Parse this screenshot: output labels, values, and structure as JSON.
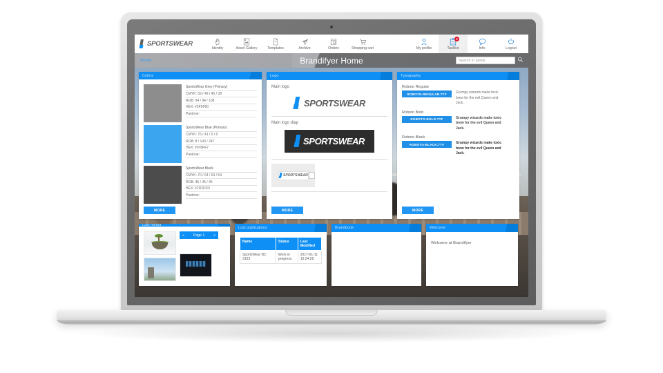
{
  "topnav": {
    "brand": "SPORTSWEAR",
    "left_items": [
      {
        "label": "Identity",
        "icon": "hand-identity-icon"
      },
      {
        "label": "Asset Gallery",
        "icon": "image-gallery-icon"
      },
      {
        "label": "Templates",
        "icon": "document-template-icon"
      },
      {
        "label": "Archive",
        "icon": "paper-plane-archive-icon"
      },
      {
        "label": "Orders",
        "icon": "box-orders-icon"
      },
      {
        "label": "Shopping cart",
        "icon": "shopping-cart-icon"
      }
    ],
    "right_items": [
      {
        "label": "My profile",
        "icon": "user-profile-icon",
        "badge": "",
        "active": false
      },
      {
        "label": "Tasklist",
        "icon": "clipboard-tasklist-icon",
        "badge": "2",
        "active": true
      },
      {
        "label": "Info",
        "icon": "speech-bubble-info-icon",
        "badge": "",
        "active": false
      },
      {
        "label": "Logout",
        "icon": "power-logout-icon",
        "badge": "",
        "active": false
      }
    ]
  },
  "subbar": {
    "breadcrumb": "Home",
    "title": "Brandifyer Home",
    "search_placeholder": "Search in portal",
    "search_value": "",
    "search_icon": "magnifier-icon"
  },
  "panels": {
    "colors": {
      "title": "Colors",
      "more_label": "MORE",
      "items": [
        {
          "name": "SportsWear Grey (Primary)",
          "cmyk": "CMYK: 59 / 49 / 45 / 38",
          "rgb": "RGB: 94 / 94 / 108",
          "hex": "HEX: #5F5F60",
          "pantone": "Pantone:",
          "swatch": "#8d8d8d"
        },
        {
          "name": "SportsWear Blue (Primary)",
          "cmyk": "CMYK: 75 / 41 / 0 / 0",
          "rgb": "RGB: 8 / 143 / 247",
          "hex": "HEX: #078FF7",
          "pantone": "Pantone:",
          "swatch": "#3ca5f0"
        },
        {
          "name": "SportsWear Black",
          "cmyk": "CMYK: 70 / 64 / 63 / 64",
          "rgb": "RGB: 45 / 45 / 45",
          "hex": "HEX: #2D2D2D",
          "pantone": "Pantone:",
          "swatch": "#4c4c4c"
        }
      ]
    },
    "logo": {
      "title": "Logo",
      "main_label": "Main logo",
      "diap_label": "Main logo diap",
      "logo_text": "SPORTSWEAR",
      "more_label": "MORE"
    },
    "typography": {
      "title": "Typography",
      "more_label": "MORE",
      "items": [
        {
          "name": "Roboto Regular",
          "button": "ROBOTO-REGULAR.TTF",
          "pangram": "Grumpy wizards make toxic brew for the evil Queen and Jack."
        },
        {
          "name": "Roboto Bold",
          "button": "ROBOTO-BOLD.TTF",
          "pangram": "Grumpy wizards make toxic brew for the evil Queen and Jack."
        },
        {
          "name": "Roboto Black",
          "button": "ROBOTO-BLACK.TTF",
          "pangram": "Grumpy wizards make toxic brew for the evil Queen and Jack."
        }
      ]
    },
    "last_media": {
      "title": "Last media",
      "pager_prev": "«",
      "pager_label": "Page 1",
      "pager_next": "»"
    },
    "last_publications": {
      "title": "Last publications",
      "columns": [
        "Name",
        "Status",
        "Last Modified"
      ],
      "rows": [
        [
          "SportsWear BC 3103",
          "Work in progress",
          "2017-01-11 10:24:28"
        ]
      ]
    },
    "brandbook": {
      "title": "Brandbook"
    },
    "welcome": {
      "title": "Welcome",
      "text": "Welcome at Brandifyer"
    }
  },
  "colors": {
    "accent_blue": "#0d8ff5",
    "button_blue": "#2196f3",
    "badge_red": "#e3152a",
    "grey": "#5f5f60"
  }
}
